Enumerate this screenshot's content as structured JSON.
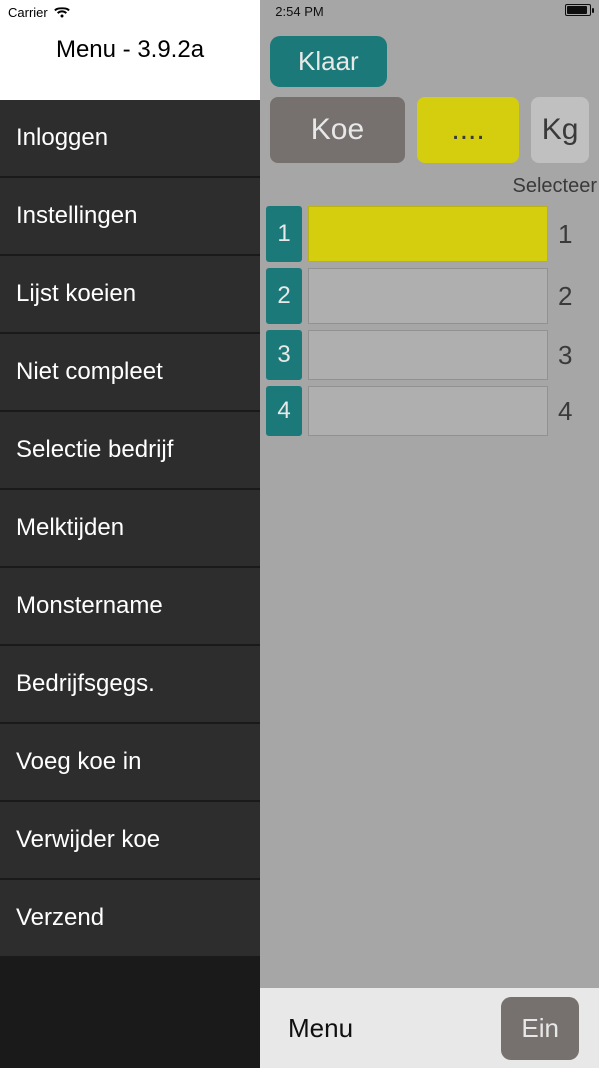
{
  "status": {
    "carrier": "Carrier",
    "time": "2:54 PM"
  },
  "main": {
    "klaar_label": "Klaar",
    "koe_label": "Koe",
    "dots_label": "....",
    "kg_label": "Kg",
    "select_label": "Selecteer",
    "rows": [
      {
        "left": "1",
        "right": "1",
        "highlight": true
      },
      {
        "left": "2",
        "right": "2",
        "highlight": false
      },
      {
        "left": "3",
        "right": "3",
        "highlight": false
      },
      {
        "left": "4",
        "right": "4",
        "highlight": false
      }
    ],
    "bottom_menu_label": "Menu",
    "bottom_ein_label": "Ein"
  },
  "sidebar": {
    "title": "Menu - 3.9.2a",
    "items": [
      {
        "label": "Inloggen"
      },
      {
        "label": "Instellingen"
      },
      {
        "label": "Lijst koeien"
      },
      {
        "label": "Niet compleet"
      },
      {
        "label": "Selectie bedrijf"
      },
      {
        "label": "Melktijden"
      },
      {
        "label": "Monstername"
      },
      {
        "label": "Bedrijfsgegs."
      },
      {
        "label": "Voeg koe in"
      },
      {
        "label": "Verwijder koe"
      },
      {
        "label": "Verzend"
      }
    ]
  }
}
